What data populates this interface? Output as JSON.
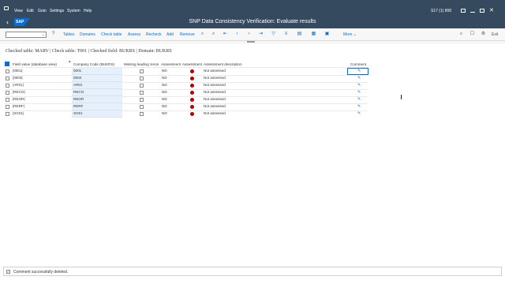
{
  "menubar": {
    "items": [
      "View",
      "Edit",
      "Goto",
      "Settings",
      "System",
      "Help"
    ],
    "system_info": "S17 (1) 800"
  },
  "titlebar": {
    "logo": "SAP",
    "title": "SNP Data Consistency Verification: Evaluate results"
  },
  "toolbar": {
    "buttons": [
      "Tables",
      "Domains",
      "Check table",
      "Assess",
      "Recheck",
      "Add",
      "Remove"
    ],
    "more": "More",
    "icons": [
      "help-icon",
      "search-icon",
      "find-next-icon",
      "first-page-icon",
      "prev-page-icon",
      "next-page-icon",
      "last-page-icon",
      "layout-icon",
      "print-icon",
      "settings-icon",
      "logoff-icon"
    ],
    "exit": "Exit"
  },
  "info_line": "Checked table: MARV | Check table: T001 | Checked field: BUKRS | Domain: BUKRS",
  "table": {
    "columns": [
      "Field value (database view)",
      "Company Code (BUKRS)",
      "Missing leading zeros",
      "Assessment",
      "Assessment",
      "Assessment description",
      "Comment"
    ],
    "rows": [
      {
        "field": "|0001|",
        "code": "0001",
        "assessment": "ND",
        "description": "Not assessed"
      },
      {
        "field": "|0003|",
        "code": "0003",
        "assessment": "ND",
        "description": "Not assessed"
      },
      {
        "field": "|AR01|",
        "code": "AR01",
        "assessment": "ND",
        "description": "Not assessed"
      },
      {
        "field": "|RECO|",
        "code": "RECO",
        "assessment": "ND",
        "description": "Not assessed"
      },
      {
        "field": "|REOR|",
        "code": "REOR",
        "assessment": "ND",
        "description": "Not assessed"
      },
      {
        "field": "|RERF|",
        "code": "RERF",
        "assessment": "ND",
        "description": "Not assessed"
      },
      {
        "field": "|SG01|",
        "code": "SG01",
        "assessment": "ND",
        "description": "Not assessed"
      }
    ],
    "status_color": "#b00000"
  },
  "status": {
    "message": "Comment successfully deleted."
  }
}
